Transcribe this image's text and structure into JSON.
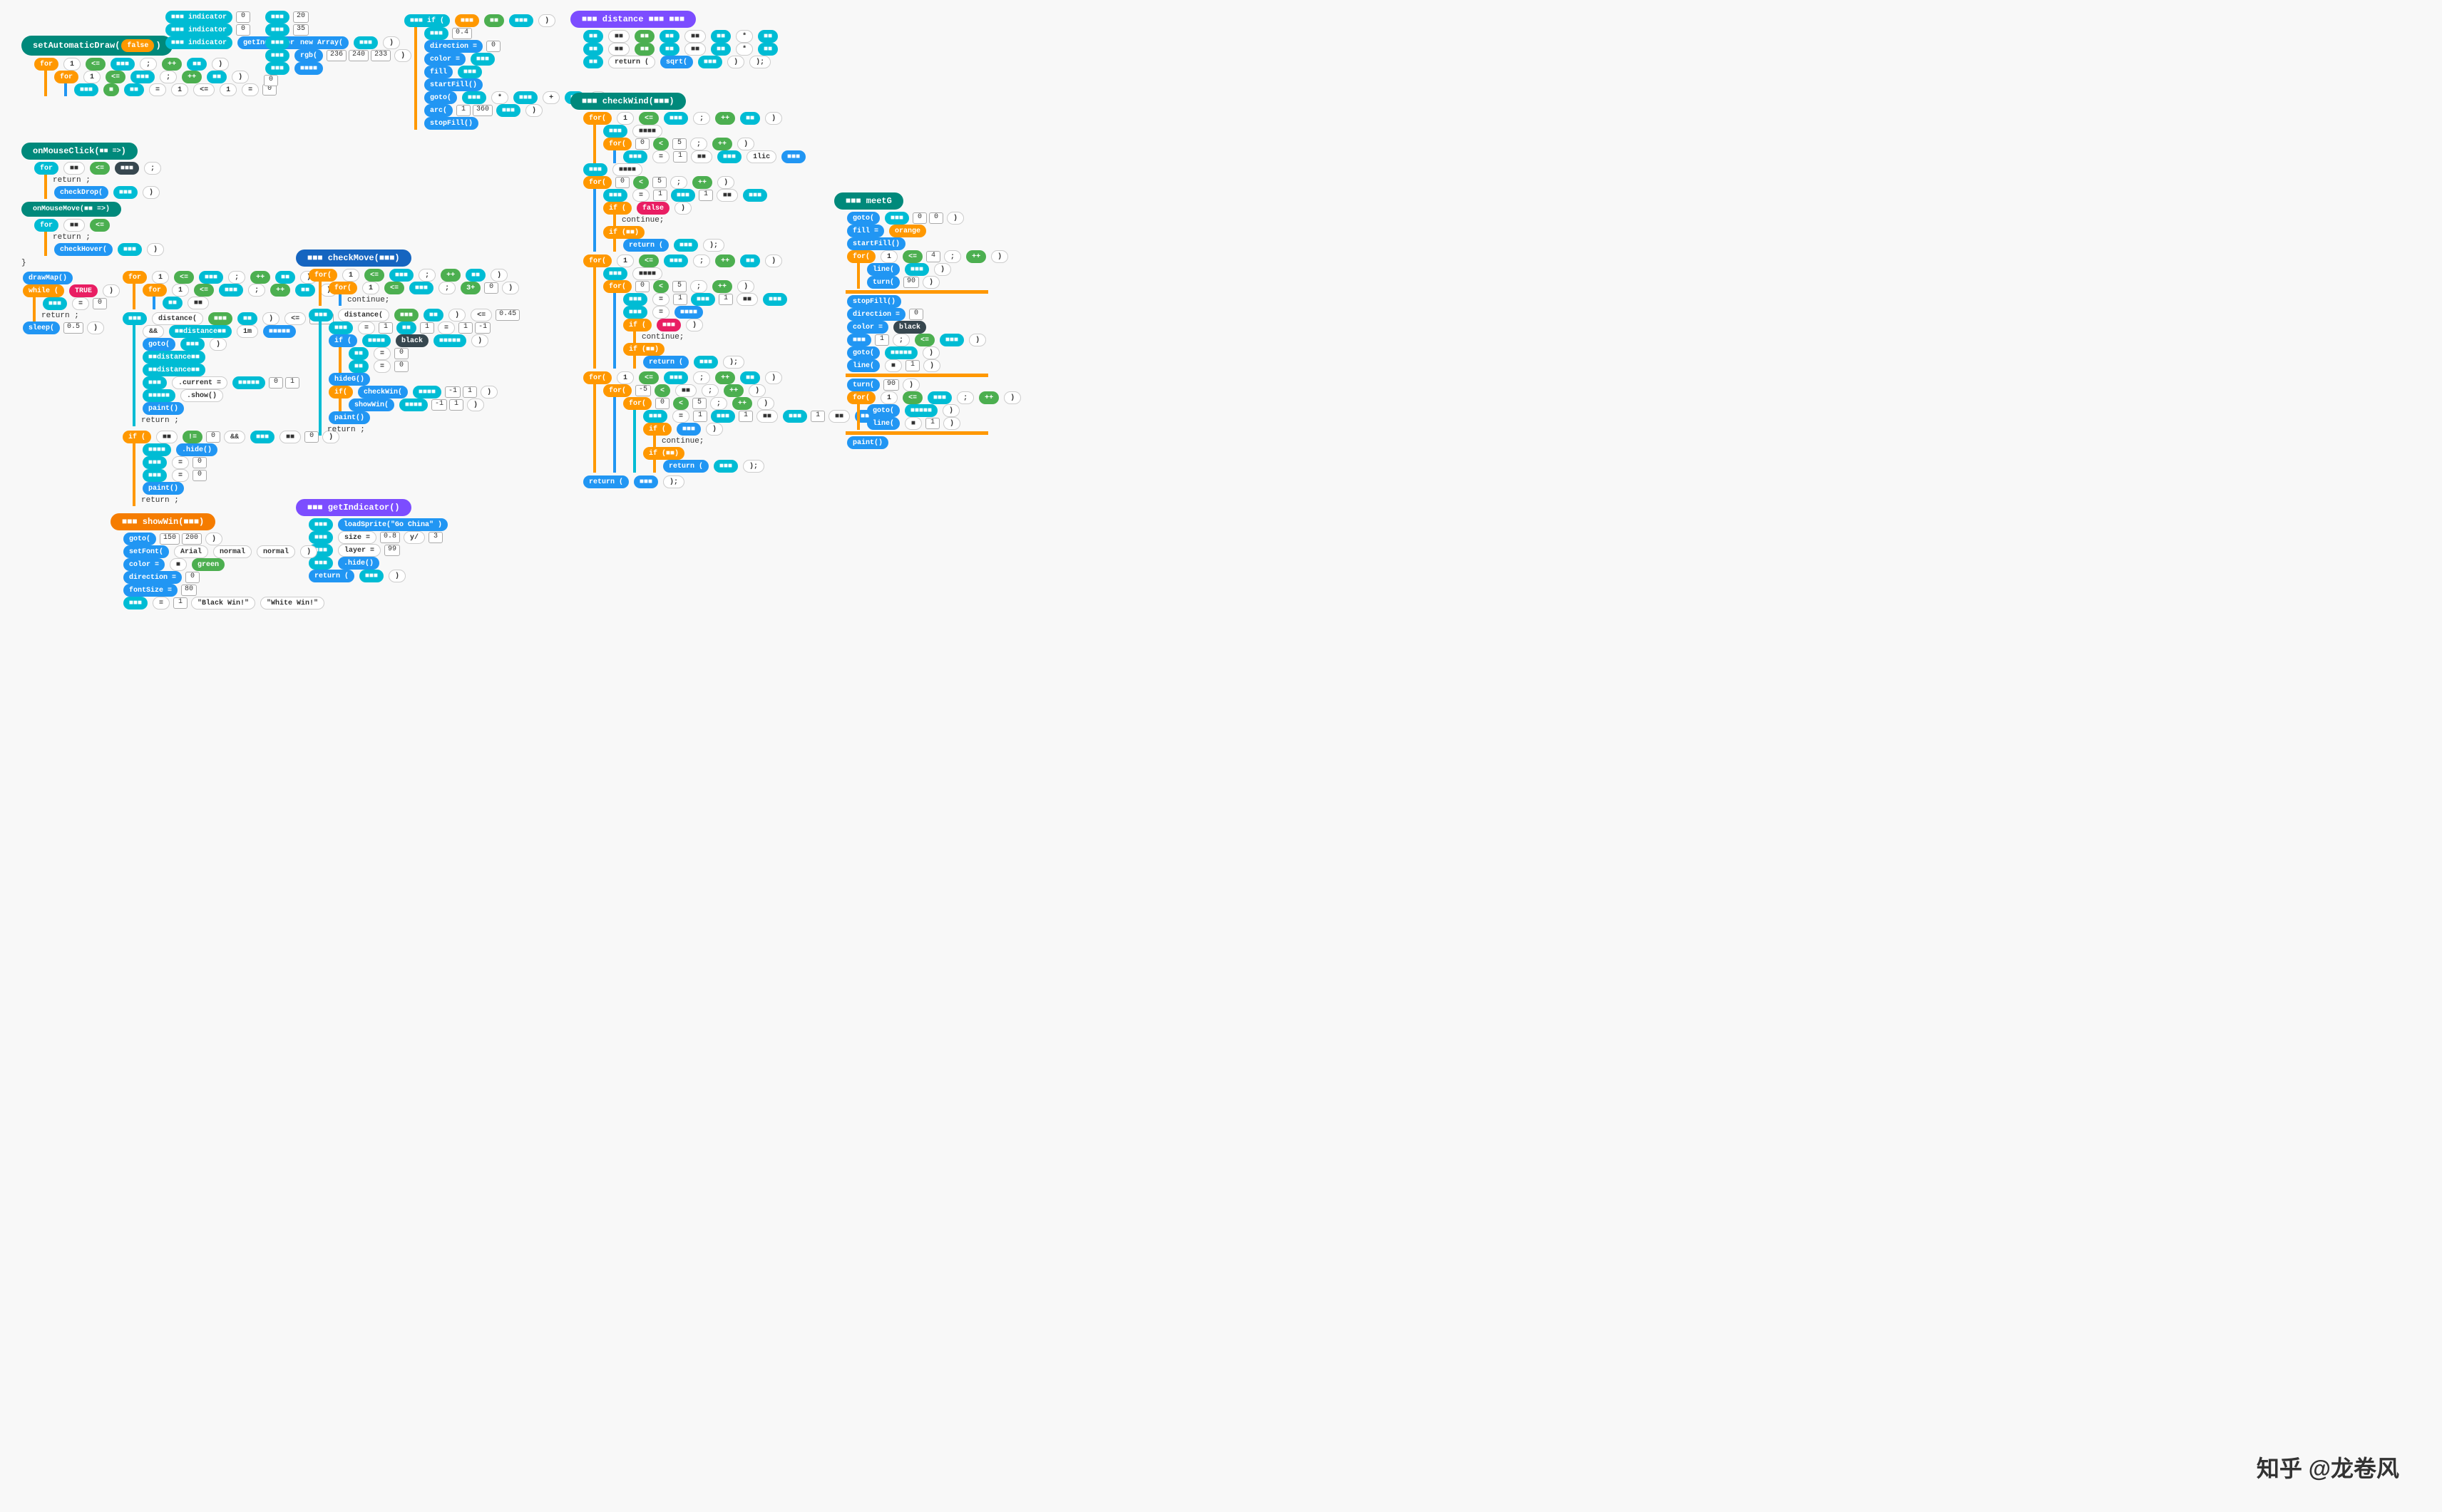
{
  "watermark": "知乎 @龙卷风",
  "blocks": {
    "section1": {
      "title": "setAutomaticDraw(false)",
      "for_label": "for",
      "items": [
        "1",
        "0"
      ]
    }
  }
}
